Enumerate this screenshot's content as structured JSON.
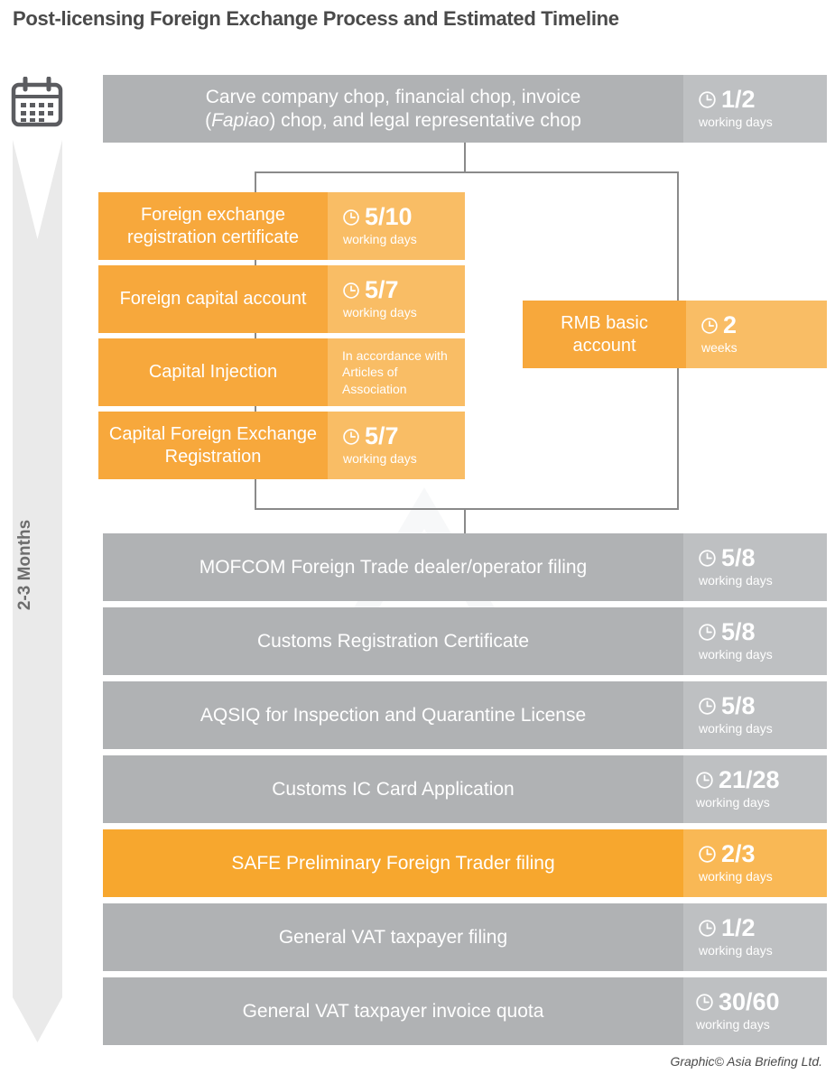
{
  "page": {
    "title": "Post-licensing Foreign Exchange Process and Estimated Timeline",
    "footer": "Graphic© Asia Briefing Ltd.",
    "timeline_label": "2-3 Months",
    "calendar_icon": "calendar-icon",
    "clock_icon": "clock-icon",
    "colors": {
      "gray_label": "#b0b2b4",
      "gray_time": "#bec0c2",
      "orange_label": "#f7a83c",
      "orange_time": "#f9bd65",
      "orange_highlight_label": "#f7a72e",
      "connector": "#8a8a8a",
      "arrow": "#eaeaea",
      "text_dark": "#4a4a4a"
    }
  },
  "top_step": {
    "label_line1": "Carve company chop, financial chop, invoice",
    "label_line2_italic": "Fapiao",
    "label_line2_pre": "(",
    "label_line2_post": ") chop, and legal representative chop",
    "duration": "1/2",
    "unit": "working days",
    "style": "gray"
  },
  "branch_left": [
    {
      "label": "Foreign exchange registration certificate",
      "duration": "5/10",
      "unit": "working days",
      "note": "",
      "style": "orange"
    },
    {
      "label": "Foreign capital account",
      "duration": "5/7",
      "unit": "working days",
      "note": "",
      "style": "orange"
    },
    {
      "label": "Capital Injection",
      "duration": "",
      "unit": "",
      "note": "In accordance with Articles of Association",
      "style": "orange"
    },
    {
      "label": "Capital Foreign Exchange Registration",
      "duration": "5/7",
      "unit": "working days",
      "note": "",
      "style": "orange"
    }
  ],
  "branch_right": {
    "label": "RMB basic account",
    "duration": "2",
    "unit": "weeks",
    "style": "orange"
  },
  "bottom_steps": [
    {
      "label": "MOFCOM Foreign Trade dealer/operator filing",
      "duration": "5/8",
      "unit": "working days",
      "style": "gray"
    },
    {
      "label": "Customs Registration Certificate",
      "duration": "5/8",
      "unit": "working days",
      "style": "gray"
    },
    {
      "label": "AQSIQ for Inspection and Quarantine License",
      "duration": "5/8",
      "unit": "working days",
      "style": "gray"
    },
    {
      "label": "Customs IC Card Application",
      "duration": "21/28",
      "unit": "working days",
      "style": "gray"
    },
    {
      "label": "SAFE Preliminary Foreign Trader filing",
      "duration": "2/3",
      "unit": "working days",
      "style": "orange-dark"
    },
    {
      "label": "General VAT taxpayer filing",
      "duration": "1/2",
      "unit": "working days",
      "style": "gray"
    },
    {
      "label": "General VAT taxpayer invoice quota",
      "duration": "30/60",
      "unit": "working days",
      "style": "gray"
    }
  ]
}
